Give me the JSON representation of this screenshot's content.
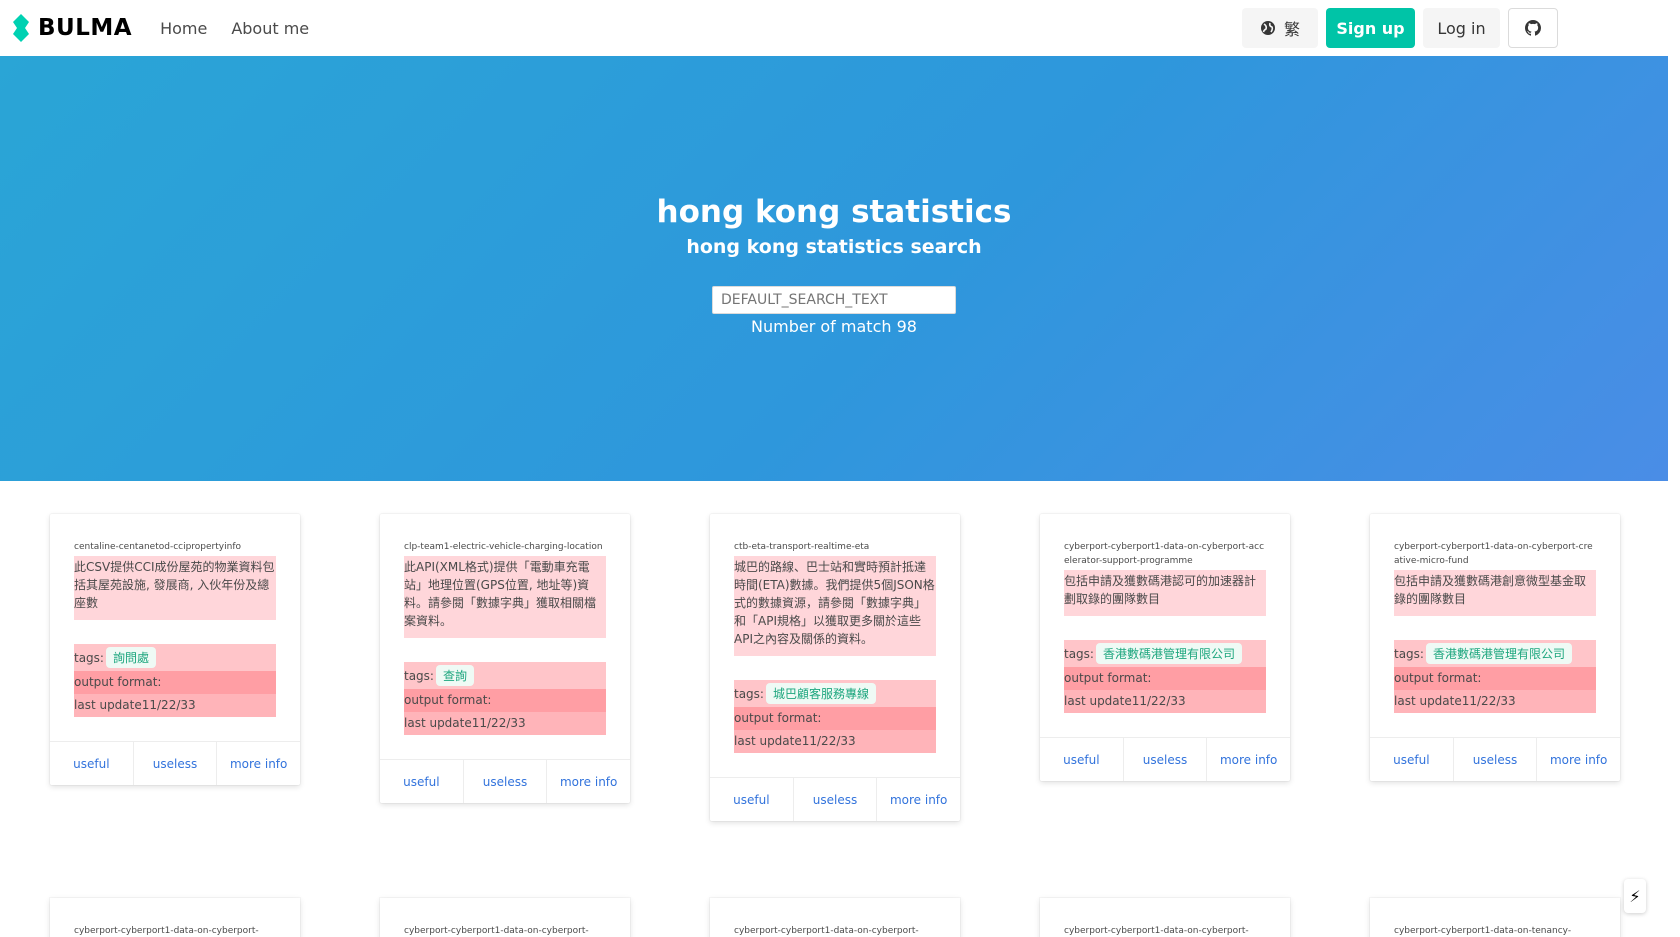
{
  "brand": {
    "name": "BULMA",
    "logo_icon": "bulma-logo-icon",
    "logo_color": "#00d1b2"
  },
  "nav": {
    "links": [
      "Home",
      "About me"
    ]
  },
  "header_actions": {
    "language_label": "繁",
    "language_icon": "globe-icon",
    "signup_label": "Sign up",
    "login_label": "Log in",
    "github_icon": "github-icon",
    "signup_color": "#00c4a7"
  },
  "hero": {
    "title": "hong kong statistics",
    "subtitle": "hong kong statistics search",
    "search_placeholder": "DEFAULT_SEARCH_TEXT",
    "match_count": "Number of match 98"
  },
  "labels": {
    "tags": "tags:",
    "output_format": "output format:",
    "last_update": "last update11/22/33",
    "useful": "useful",
    "useless": "useless",
    "more_info": "more info"
  },
  "cards": [
    {
      "title": "centaline-centanetod-ccipropertyinfo",
      "description": "此CSV提供CCI成份屋苑的物業資料包括其屋苑設施, 發展商, 入伙年份及總座數",
      "tag": "詢問處"
    },
    {
      "title": "clp-team1-electric-vehicle-charging-location",
      "description": "此API(XML格式)提供「電動車充電站」地理位置(GPS位置, 地址等)資料。請參閱「數據字典」獲取相關檔案資料。",
      "tag": "查詢"
    },
    {
      "title": "ctb-eta-transport-realtime-eta",
      "description": "城巴的路線、巴士站和實時預計抵達時間(ETA)數據。我們提供5個JSON格式的數據資源，請參閱「數據字典」和「API規格」以獲取更多關於這些API之內容及關係的資料。",
      "tag": "城巴顧客服務專線"
    },
    {
      "title": "cyberport-cyberport1-data-on-cyberport-accelerator-support-programme",
      "description": "包括申請及獲數碼港認可的加速器計劃取錄的團隊數目",
      "tag": "香港數碼港管理有限公司"
    },
    {
      "title": "cyberport-cyberport1-data-on-cyberport-creative-micro-fund",
      "description": "包括申請及獲數碼港創意微型基金取錄的團隊數目",
      "tag": "香港數碼港管理有限公司"
    }
  ],
  "partial_cards": [
    "cyberport-cyberport1-data-on-cyberport-",
    "cyberport-cyberport1-data-on-cyberport-",
    "cyberport-cyberport1-data-on-cyberport-",
    "cyberport-cyberport1-data-on-cyberport-",
    "cyberport-cyberport1-data-on-tenancy-"
  ],
  "floating_button_icon": "lightning-icon",
  "floating_button_glyph": "⚡"
}
